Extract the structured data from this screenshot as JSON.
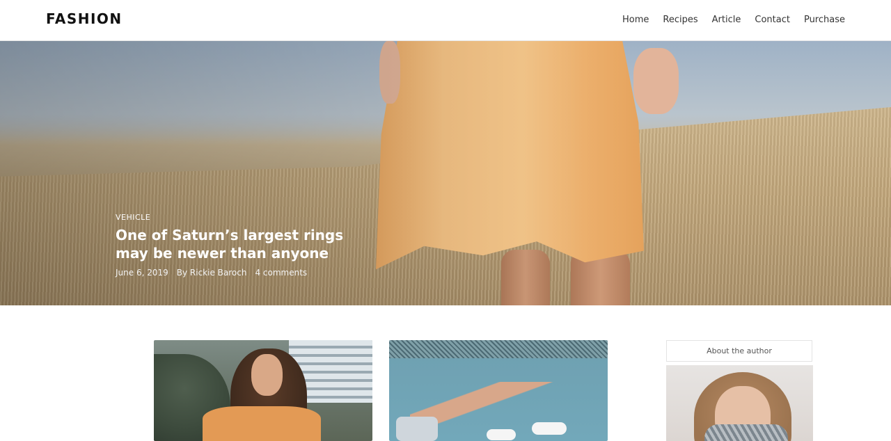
{
  "header": {
    "logo": "FASHION",
    "nav": [
      "Home",
      "Recipes",
      "Article",
      "Contact",
      "Purchase"
    ]
  },
  "hero": {
    "category": "VEHICLE",
    "title": "One of Saturn’s largest rings may be newer than anyone",
    "date": "June 6, 2019",
    "author": "By Rickie Baroch",
    "comments": "4 comments"
  },
  "sidebar": {
    "title": "About the author"
  },
  "colors": {
    "header_bg": "#ffffff",
    "text_dark": "#111111",
    "hero_text": "#ffffff"
  }
}
